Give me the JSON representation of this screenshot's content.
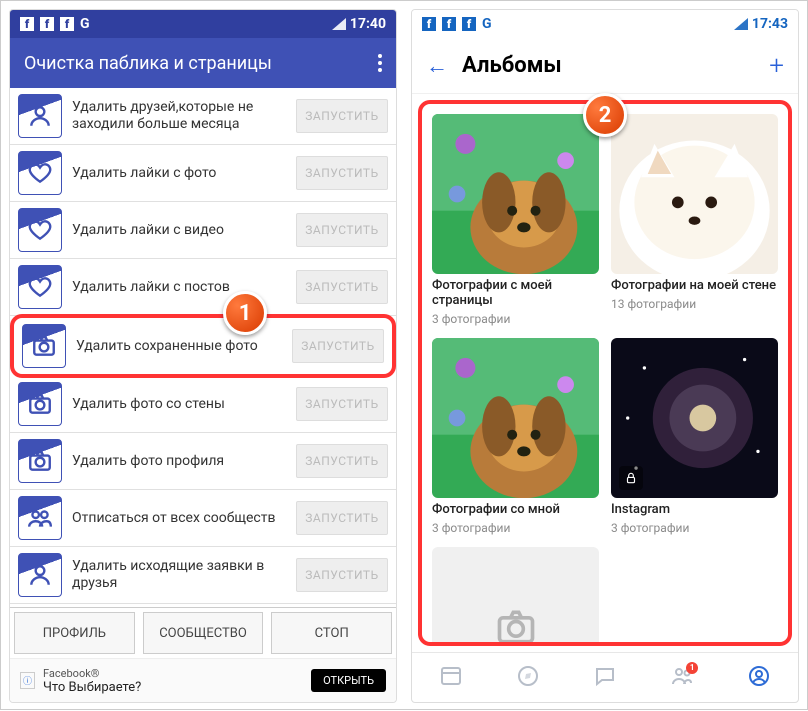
{
  "left": {
    "time": "17:40",
    "icons": [
      "fb",
      "fb",
      "fb",
      "G"
    ],
    "app_title": "Очистка паблика и страницы",
    "launch_label": "ЗАПУСТИТЬ",
    "rows": [
      {
        "label": "Удалить друзей,которые не заходили больше месяца",
        "icon": "person"
      },
      {
        "label": "Удалить лайки с фото",
        "icon": "heart"
      },
      {
        "label": "Удалить лайки с видео",
        "icon": "heart"
      },
      {
        "label": "Удалить лайки с постов",
        "icon": "heart"
      },
      {
        "label": "Удалить сохраненные фото",
        "icon": "camera",
        "highlight": true
      },
      {
        "label": "Удалить фото со стены",
        "icon": "camera"
      },
      {
        "label": "Удалить фото профиля",
        "icon": "camera"
      },
      {
        "label": "Отписаться от всех сообществ",
        "icon": "group"
      },
      {
        "label": "Удалить исходящие заявки в друзья",
        "icon": "person"
      }
    ],
    "bottom_buttons": [
      "ПРОФИЛЬ",
      "СООБЩЕСТВО",
      "СТОП"
    ],
    "ad": {
      "brand": "Facebook®",
      "line": "Что Выбираете?",
      "cta": "ОТКРЫТЬ"
    }
  },
  "right": {
    "time": "17:43",
    "icons": [
      "fb",
      "fb",
      "fb",
      "G"
    ],
    "header_title": "Альбомы",
    "albums": [
      {
        "title": "Фотографии с моей страницы",
        "count": "3 фотографии",
        "kind": "dog"
      },
      {
        "title": "Фотографии на моей стене",
        "count": "13 фотографии",
        "kind": "fox"
      },
      {
        "title": "Фотографии со мной",
        "count": "3 фотографии",
        "kind": "dog"
      },
      {
        "title": "Instagram",
        "count": "3 фотографии",
        "kind": "space",
        "locked": true
      }
    ],
    "nav_notif": "1"
  },
  "callouts": {
    "one": "1",
    "two": "2"
  }
}
